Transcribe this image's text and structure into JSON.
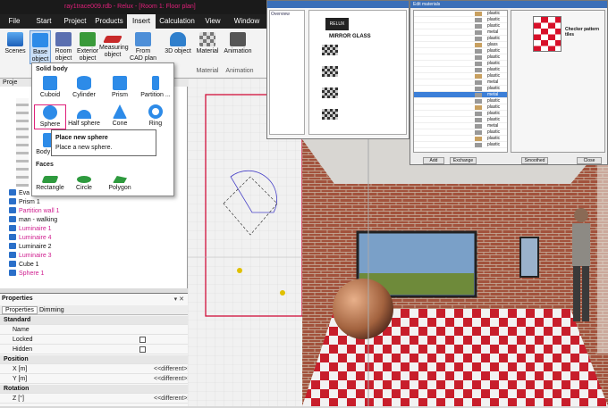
{
  "window": {
    "title": "ray1trace009.rdb - Relux - [Room 1: Floor plan]"
  },
  "menu": [
    "File",
    "Start",
    "Project",
    "Products",
    "Insert",
    "Calculation",
    "View",
    "Window"
  ],
  "menu_active": "Insert",
  "ribbon": {
    "scenes": "Scenes",
    "base_object": "Base object",
    "room_object": "Room object",
    "exterior_object": "Exterior object",
    "measuring_object": "Measuring object",
    "from_cad": "From CAD plan",
    "object_3d": "3D object",
    "material": "Material",
    "animation": "Animation",
    "group_material": "Material",
    "group_animation": "Animation"
  },
  "dropdown": {
    "heading_solid": "Solid body",
    "items_solid": [
      "Cuboid",
      "Cylinder",
      "Prism",
      "Partition ...",
      "Sphere",
      "Half sphere",
      "Cone",
      "Ring",
      "Body of ..."
    ],
    "heading_faces": "Faces",
    "items_faces": [
      "Rectangle",
      "Circle",
      "Polygon"
    ]
  },
  "tooltip": {
    "title": "Place new sphere",
    "desc": "Place a new sphere."
  },
  "leftpanel": {
    "title": "Proje",
    "tree": [
      {
        "label": "Eva",
        "color": "#111"
      },
      {
        "label": "Prism 1",
        "color": "#111"
      },
      {
        "label": "Partition wall 1",
        "color": "#d02090"
      },
      {
        "label": "man - walking",
        "color": "#111"
      },
      {
        "label": "Luminaire 1",
        "color": "#d02090"
      },
      {
        "label": "Luminaire 4",
        "color": "#d02090"
      },
      {
        "label": "Luminaire 2",
        "color": "#111"
      },
      {
        "label": "Luminaire 3",
        "color": "#d02090"
      },
      {
        "label": "Cube 1",
        "color": "#111"
      },
      {
        "label": "Sphere 1",
        "color": "#d02090"
      }
    ]
  },
  "properties": {
    "title": "Properties",
    "tabs": [
      "Properties",
      "Dimming"
    ],
    "rows": [
      {
        "name": "Standard",
        "section": true,
        "value": ""
      },
      {
        "name": "Name",
        "section": false,
        "value": ""
      },
      {
        "name": "Locked",
        "section": false,
        "value": "checkbox"
      },
      {
        "name": "Hidden",
        "section": false,
        "value": "checkbox"
      },
      {
        "name": "Position",
        "section": true,
        "value": ""
      },
      {
        "name": "X [m]",
        "section": false,
        "value": "<<different>>"
      },
      {
        "name": "Y [m]",
        "section": false,
        "value": "<<different>>"
      },
      {
        "name": "Rotation",
        "section": true,
        "value": ""
      },
      {
        "name": "Z [°]",
        "section": false,
        "value": "<<different>>"
      }
    ]
  },
  "matwin": {
    "heading": "MIRROR GLASS",
    "logo": "RELUX",
    "tab": "Overview"
  },
  "editwin": {
    "title": "Edit materials",
    "right_title": "Checker pattern tiles",
    "buttons": [
      "Add",
      "Exchange",
      "Smoothed",
      "Close"
    ],
    "list_types": [
      "plastic",
      "plastic",
      "plastic",
      "metal",
      "plastic",
      "glass",
      "plastic",
      "plastic",
      "plastic",
      "plastic",
      "plastic",
      "metal",
      "plastic",
      "metal",
      "plastic",
      "plastic",
      "plastic",
      "plastic",
      "metal",
      "plastic",
      "plastic",
      "plastic"
    ]
  },
  "colors": {
    "accent": "#e0207a",
    "ribbon_blue": "#2d8be8",
    "selection": "#3c7fd8"
  }
}
